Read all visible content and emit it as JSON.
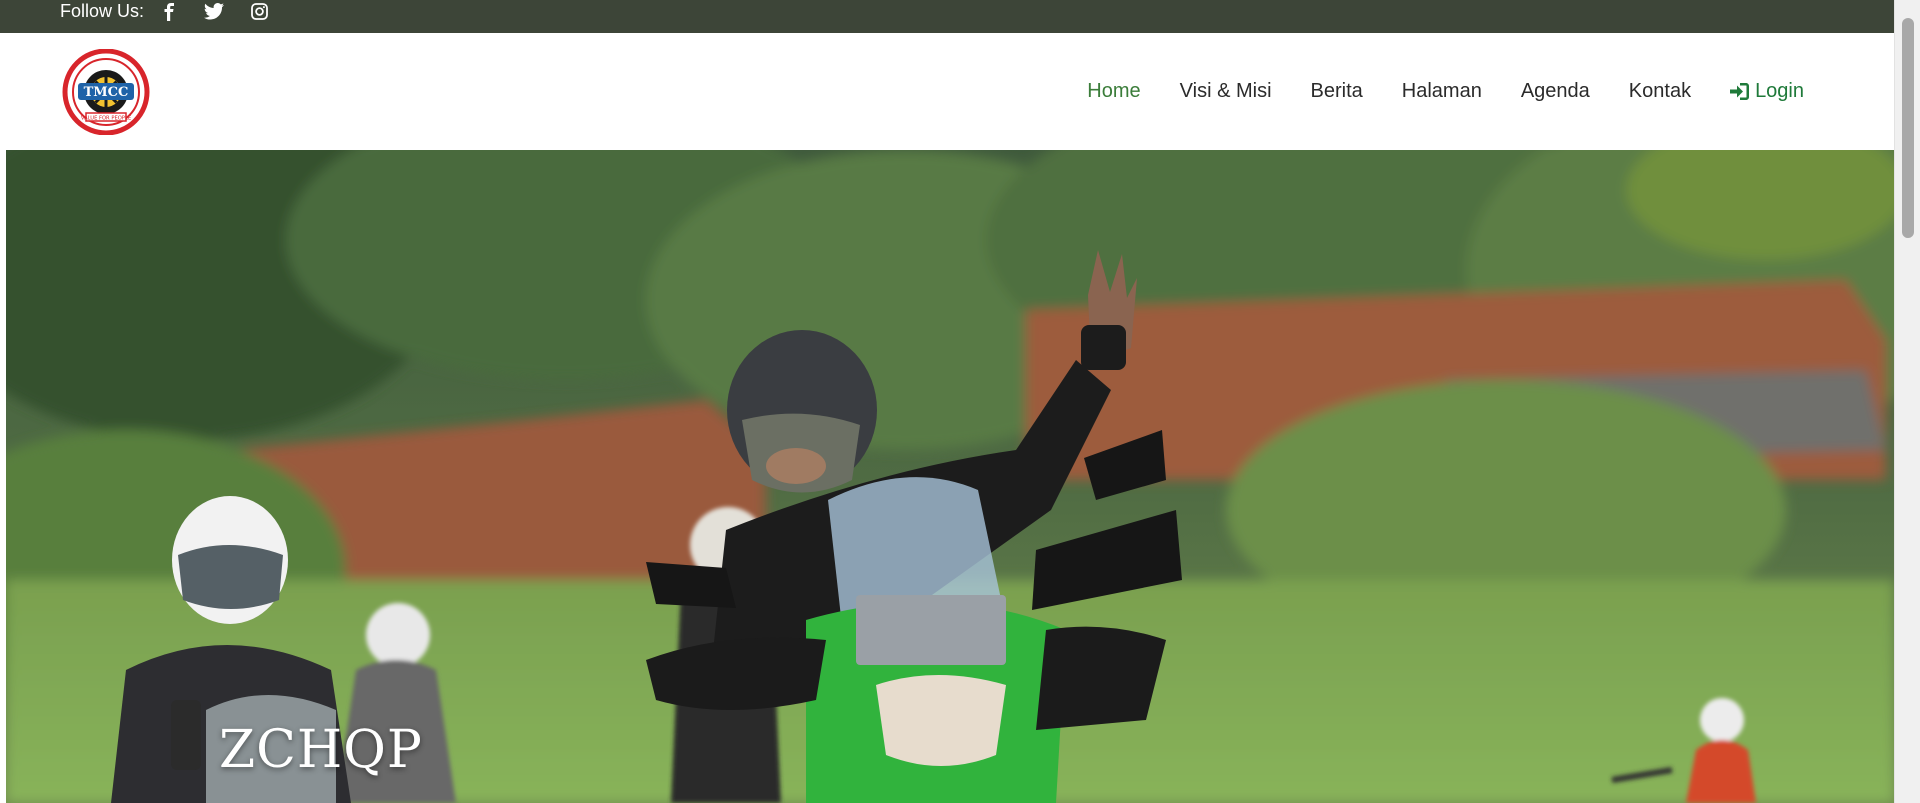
{
  "topbar": {
    "follow_label": "Follow Us:",
    "social_icons": [
      "facebook-icon",
      "twitter-icon",
      "instagram-icon"
    ]
  },
  "header": {
    "logo": {
      "text": "TMCC",
      "motto": "VALUE FOR PEOPLE"
    },
    "nav": {
      "home": "Home",
      "visi_misi": "Visi & Misi",
      "berita": "Berita",
      "halaman": "Halaman",
      "agenda": "Agenda",
      "kontak": "Kontak",
      "login": "Login"
    },
    "active_item": "Home"
  },
  "hero": {
    "title": "ZCHQP"
  },
  "colors": {
    "topbar_bg": "#3d4538",
    "nav_active": "#3b7d3a",
    "login": "#1f7a3a"
  }
}
